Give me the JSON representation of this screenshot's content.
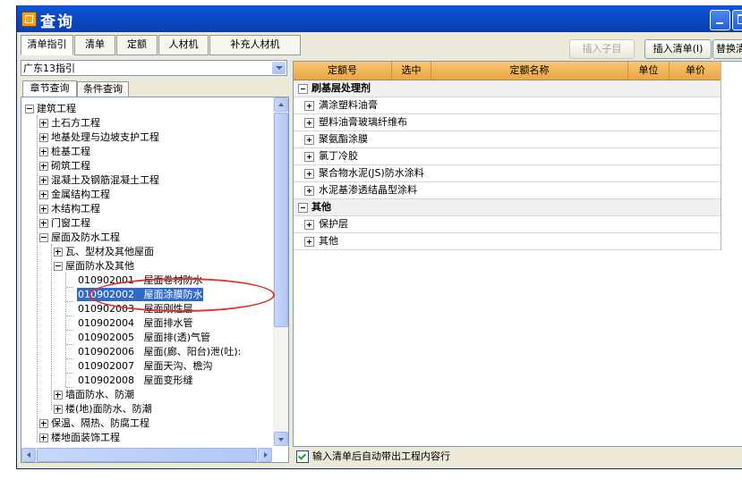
{
  "window": {
    "title": "查询"
  },
  "tabs": [
    {
      "label": "清单指引",
      "active": true
    },
    {
      "label": "清单",
      "active": false
    },
    {
      "label": "定额",
      "active": false
    },
    {
      "label": "人材机",
      "active": false
    },
    {
      "label": "补充人材机",
      "active": false
    }
  ],
  "toolbar": {
    "insert_child": "插入子目",
    "insert_list": "插入清单(I)",
    "replace": "替换清"
  },
  "combo": {
    "value": "广东13指引"
  },
  "subtabs": [
    {
      "label": "章节查询",
      "active": true
    },
    {
      "label": "条件查询",
      "active": false
    }
  ],
  "tree": [
    {
      "label": "建筑工程",
      "expander": "minus"
    },
    {
      "label": "土石方工程",
      "expander": "plus"
    },
    {
      "label": "地基处理与边坡支护工程",
      "expander": "plus"
    },
    {
      "label": "桩基工程",
      "expander": "plus"
    },
    {
      "label": "砌筑工程",
      "expander": "plus"
    },
    {
      "label": "混凝土及钢筋混凝土工程",
      "expander": "plus"
    },
    {
      "label": "金属结构工程",
      "expander": "plus"
    },
    {
      "label": "木结构工程",
      "expander": "plus"
    },
    {
      "label": "门窗工程",
      "expander": "plus"
    },
    {
      "label": "屋面及防水工程",
      "expander": "minus"
    },
    {
      "label": "瓦、型材及其他屋面",
      "expander": "plus"
    },
    {
      "label": "屋面防水及其他",
      "expander": "minus"
    },
    {
      "label": "010902001   屋面卷材防水",
      "expander": "none"
    },
    {
      "label": "010902002   屋面涂膜防水",
      "expander": "none",
      "selected": true
    },
    {
      "label": "010902003   屋面刚性层",
      "expander": "none"
    },
    {
      "label": "010902004   屋面排水管",
      "expander": "none"
    },
    {
      "label": "010902005   屋面排(透)气管",
      "expander": "none"
    },
    {
      "label": "010902006   屋面(廊、阳台)泄(吐):",
      "expander": "none"
    },
    {
      "label": "010902007   屋面天沟、檐沟",
      "expander": "none"
    },
    {
      "label": "010902008   屋面变形缝",
      "expander": "none"
    },
    {
      "label": "墙面防水、防潮",
      "expander": "plus"
    },
    {
      "label": "楼(地)面防水、防潮",
      "expander": "plus"
    },
    {
      "label": "保温、隔热、防腐工程",
      "expander": "plus"
    },
    {
      "label": "楼地面装饰工程",
      "expander": "plus"
    }
  ],
  "grid": {
    "headers": [
      "定额号",
      "选中",
      "定额名称",
      "单位",
      "单价"
    ],
    "rows": [
      {
        "type": "group",
        "text": "刷基层处理剂"
      },
      {
        "type": "item",
        "text": "满涂塑料油膏"
      },
      {
        "type": "item",
        "text": "塑料油膏玻璃纤维布"
      },
      {
        "type": "item",
        "text": "聚氨酯涂膜"
      },
      {
        "type": "item",
        "text": "氯丁冷胶"
      },
      {
        "type": "item",
        "text": "聚合物水泥(JS)防水涂料"
      },
      {
        "type": "item",
        "text": "水泥基渗透结晶型涂料"
      },
      {
        "type": "group",
        "text": "其他"
      },
      {
        "type": "item",
        "text": "保护层"
      },
      {
        "type": "item",
        "text": "其他"
      }
    ]
  },
  "footer": {
    "checkbox_label": "输入清单后自动带出工程内容行",
    "checked": true
  }
}
